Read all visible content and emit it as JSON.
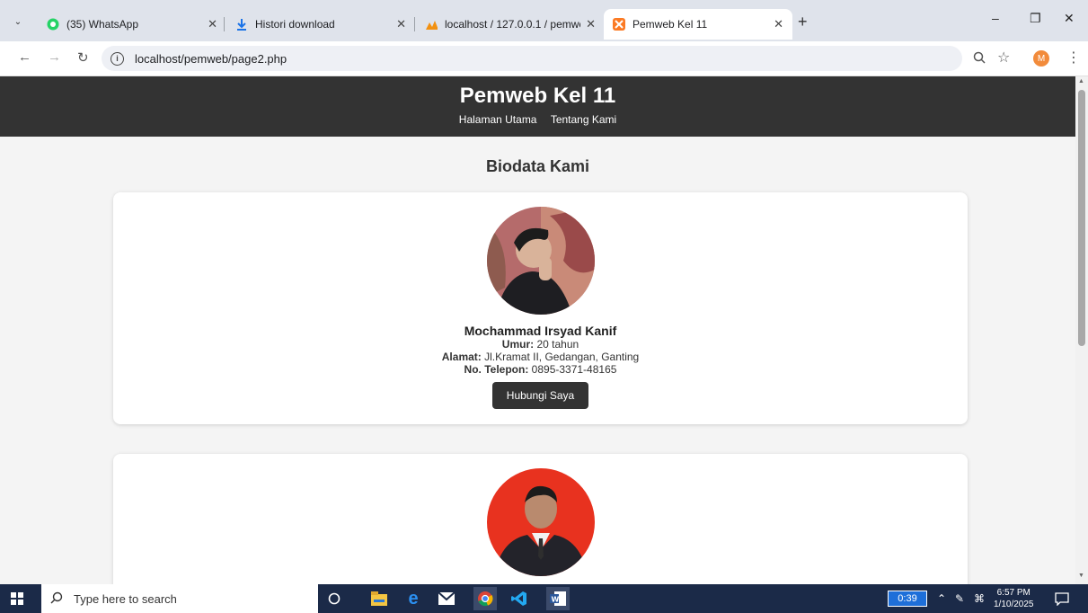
{
  "browser": {
    "tabs": [
      {
        "title": "(35) WhatsApp",
        "icon": "whatsapp-icon"
      },
      {
        "title": "Histori download",
        "icon": "download-icon"
      },
      {
        "title": "localhost / 127.0.0.1 / pemweb",
        "icon": "phpmyadmin-icon"
      },
      {
        "title": "Pemweb Kel 11",
        "icon": "xampp-icon",
        "active": true
      }
    ],
    "url": "localhost/pemweb/page2.php",
    "profile_initial": "M"
  },
  "site": {
    "title": "Pemweb Kel 11",
    "nav": [
      "Halaman Utama",
      "Tentang Kami"
    ],
    "heading": "Biodata Kami"
  },
  "members": [
    {
      "name": "Mochammad Irsyad Kanif",
      "age_label": "Umur:",
      "age": "20 tahun",
      "address_label": "Alamat:",
      "address": "Jl.Kramat II, Gedangan, Ganting",
      "phone_label": "No. Telepon:",
      "phone": "0895-3371-48165",
      "button": "Hubungi Saya"
    },
    {
      "name": "",
      "button": ""
    }
  ],
  "taskbar": {
    "search_placeholder": "Type here to search",
    "timer": "0:39",
    "time": "6:57 PM",
    "date": "1/10/2025"
  },
  "colors": {
    "header_bg": "#333333",
    "page_bg": "#f4f4f4",
    "button_bg": "#333333",
    "taskbar_bg": "#1b2a48"
  }
}
